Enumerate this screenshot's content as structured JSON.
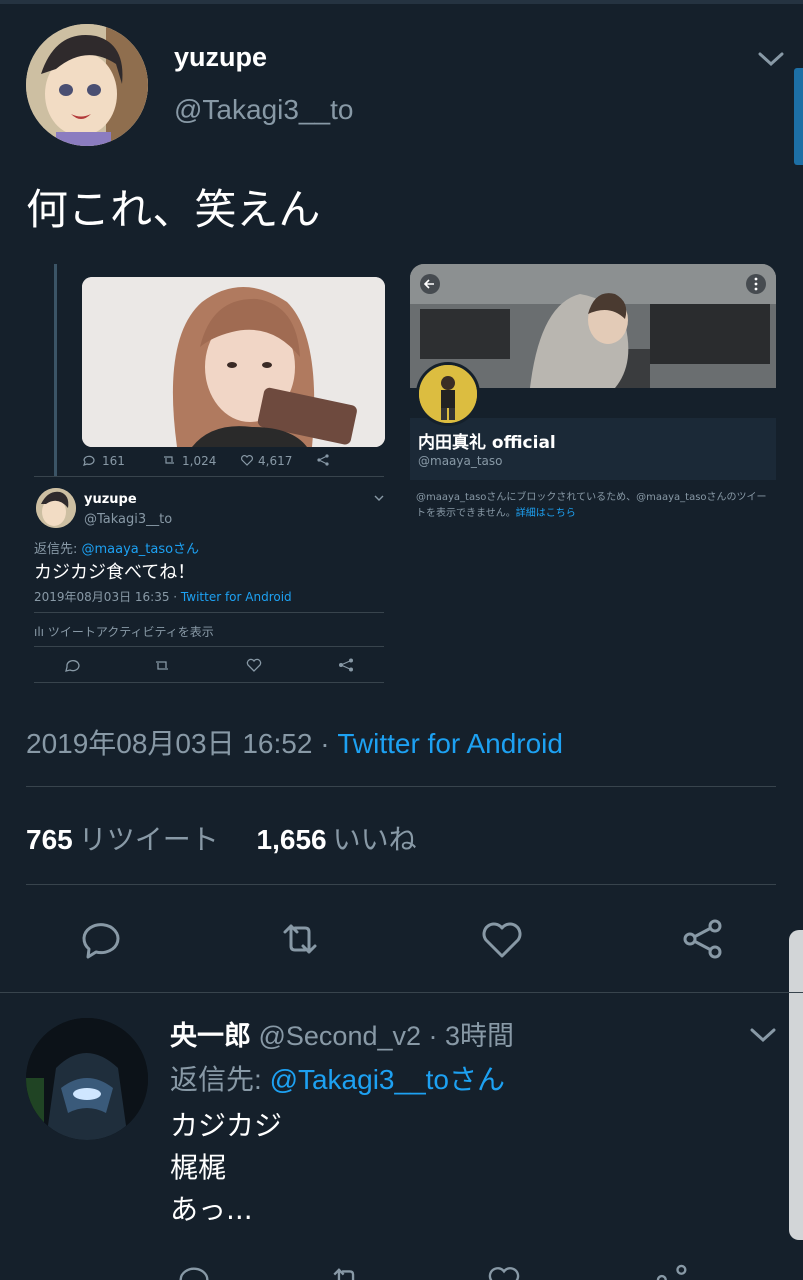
{
  "tweet": {
    "name": "yuzupe",
    "handle": "@Takagi3__to",
    "text": "何これ、笑えん",
    "timestamp": "2019年08月03日 16:52 · ",
    "source": "Twitter for Android",
    "retweets_count": "765",
    "retweets_label": "リツイート",
    "likes_count": "1,656",
    "likes_label": "いいね"
  },
  "embedded": {
    "stats": {
      "replies": "161",
      "retweets": "1,024",
      "likes": "4,617"
    },
    "reply": {
      "name": "yuzupe",
      "handle": "@Takagi3__to",
      "reply_prefix": "返信先: ",
      "reply_target": "@maaya_tasoさん",
      "text": "カジカジ食べてね！",
      "meta": "2019年08月03日 16:35 · ",
      "meta_source": "Twitter for Android",
      "activity": "ツイートアクティビティを表示"
    },
    "profile": {
      "name": "内田真礼 official",
      "handle": "@maaya_taso",
      "blocked_text": "@maaya_tasoさんにブロックされているため、@maaya_tasoさんのツイートを表示できません。",
      "details_link": "詳細はこちら"
    }
  },
  "reply2": {
    "name": "央一郎",
    "handle_time": " @Second_v2 · 3時間",
    "reply_prefix": "返信先: ",
    "reply_target": "@Takagi3__toさん",
    "lines": [
      "カジカジ",
      "梶梶",
      "あっ..."
    ]
  },
  "colors": {
    "background": "#15202b",
    "link": "#1da1f2",
    "muted": "#8899a6",
    "divider": "#38444d"
  },
  "icons": [
    "chevron-down-icon",
    "reply-icon",
    "retweet-icon",
    "like-icon",
    "share-icon",
    "back-arrow-icon",
    "more-icon"
  ]
}
